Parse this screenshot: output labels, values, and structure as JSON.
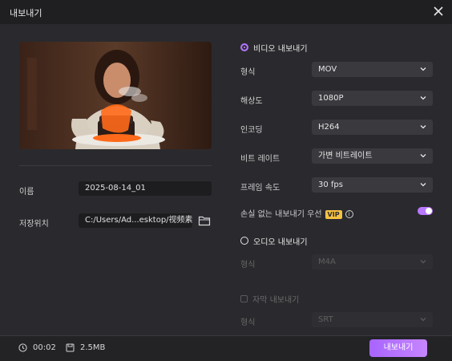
{
  "window": {
    "title": "내보내기"
  },
  "left": {
    "name_label": "이름",
    "name_value": "2025-08-14_01",
    "path_label": "저장위치",
    "path_value": "C:/Users/Ad...esktop/视频素材"
  },
  "video": {
    "label": "비디오 내보내기",
    "selected": true,
    "rows": [
      {
        "label": "형식",
        "value": "MOV"
      },
      {
        "label": "해상도",
        "value": "1080P"
      },
      {
        "label": "인코딩",
        "value": "H264"
      },
      {
        "label": "비트 레이트",
        "value": "가변 비트레이트"
      },
      {
        "label": "프레임 속도",
        "value": "30  fps"
      }
    ],
    "lossless_label": "손실 없는 내보내기 우선",
    "vip_badge": "VIP",
    "info_icon": "i",
    "lossless_enabled": true
  },
  "audio": {
    "label": "오디오 내보내기",
    "selected": false,
    "format_label": "형식",
    "format_value": "M4A"
  },
  "subtitle": {
    "label": "자막 내보내기",
    "checked": false,
    "format_label": "형식",
    "format_value": "SRT"
  },
  "footer": {
    "duration": "00:02",
    "size": "2.5MB",
    "export_button": "내보내기"
  },
  "colors": {
    "accent": "#b274ff",
    "vip": "#f5c242",
    "background": "#2a2a2e"
  }
}
